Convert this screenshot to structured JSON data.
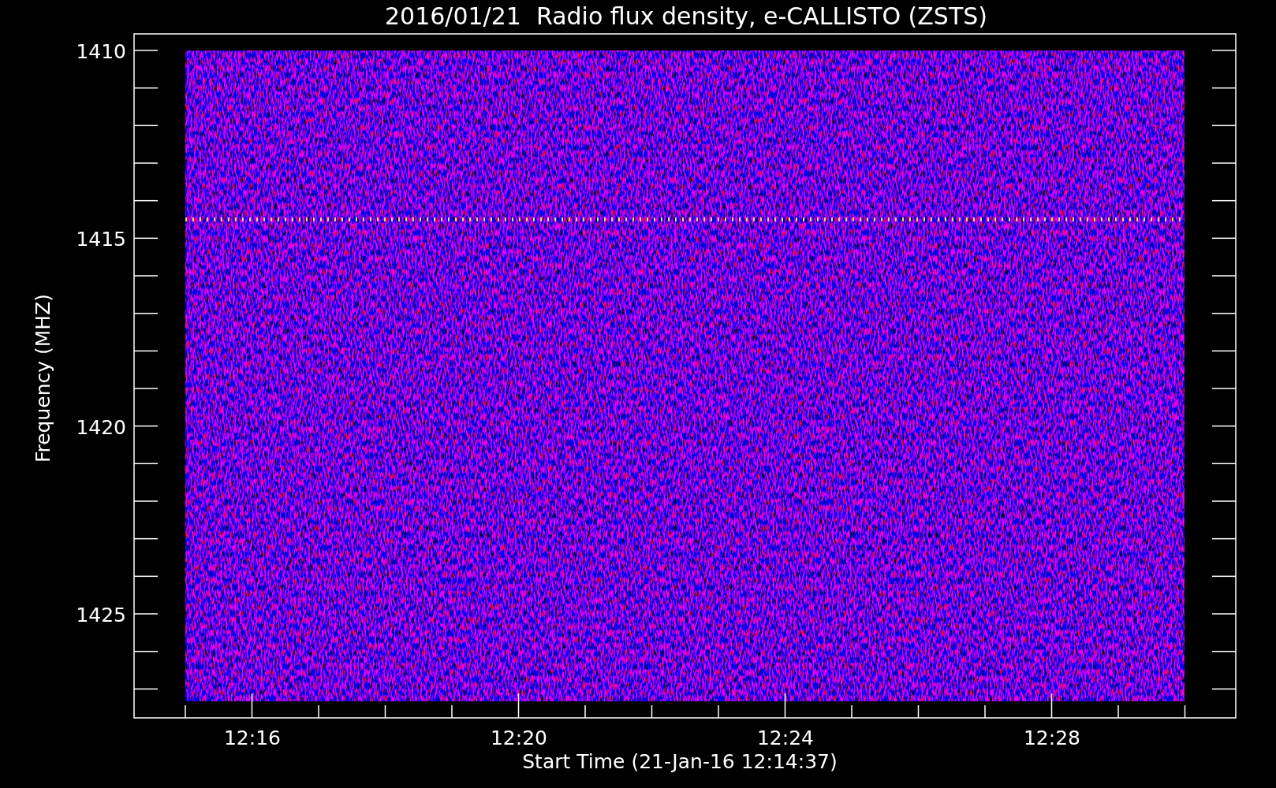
{
  "title": "2016/01/21  Radio flux density, e-CALLISTO (ZSTS)",
  "ylabel": "Frequency (MHZ)",
  "xlabel": "Start Time (21-Jan-16 12:14:37)",
  "yticks": [
    "1410",
    "1415",
    "1420",
    "1425"
  ],
  "xticks": [
    "12:16",
    "12:20",
    "12:24",
    "12:28"
  ]
}
